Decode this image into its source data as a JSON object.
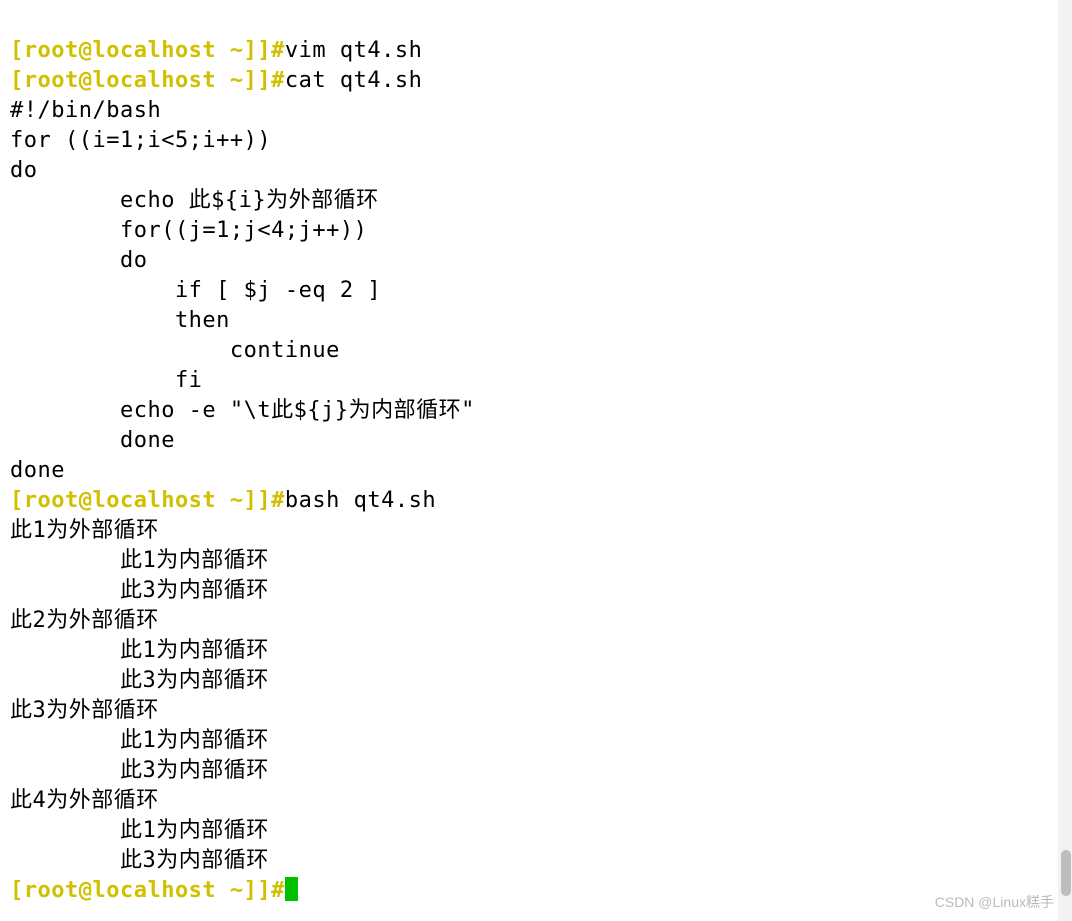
{
  "prompt1": "[root@localhost ~]]#",
  "cmd_vim": "vim qt4.sh",
  "cmd_cat": "cat qt4.sh",
  "script": {
    "l0": "#!/bin/bash",
    "l1": "for ((i=1;i<5;i++))",
    "l2": "do",
    "l3": "        echo 此${i}为外部循环",
    "l4": "        for((j=1;j<4;j++))",
    "l5": "        do",
    "l6": "            if [ $j -eq 2 ]",
    "l7": "            then",
    "l8": "                continue",
    "l9": "            fi",
    "l10": "        echo -e \"\\t此${j}为内部循环\"",
    "l11": "        done",
    "l12": "done"
  },
  "cmd_bash": "bash qt4.sh",
  "output": {
    "o0": "此1为外部循环",
    "o1": "        此1为内部循环",
    "o2": "        此3为内部循环",
    "o3": "此2为外部循环",
    "o4": "        此1为内部循环",
    "o5": "        此3为内部循环",
    "o6": "此3为外部循环",
    "o7": "        此1为内部循环",
    "o8": "        此3为内部循环",
    "o9": "此4为外部循环",
    "o10": "        此1为内部循环",
    "o11": "        此3为内部循环"
  },
  "watermark": "CSDN @Linux糕手"
}
